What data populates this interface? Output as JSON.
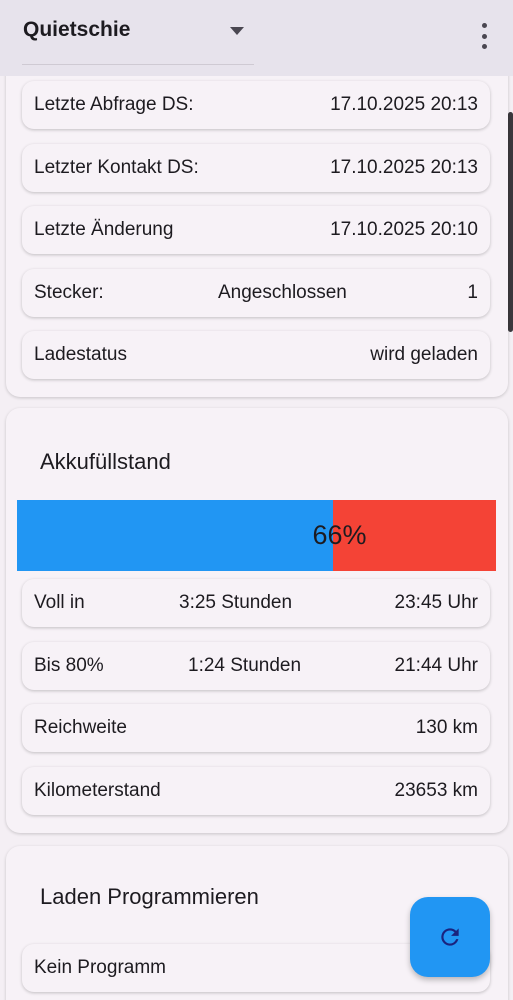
{
  "appbar": {
    "title": "Quietschie",
    "dropdown_icon": "caret-down-icon",
    "menu_icon": "more-vert-icon"
  },
  "status": {
    "last_query_label": "Letzte Abfrage DS:",
    "last_query_value": "17.10.2025 20:13",
    "last_contact_label": "Letzter Kontakt DS:",
    "last_contact_value": "17.10.2025 20:13",
    "last_change_label": "Letzte Änderung",
    "last_change_value": "17.10.2025 20:10",
    "plug_label": "Stecker:",
    "plug_state": "Angeschlossen",
    "plug_number": "1",
    "charge_label": "Ladestatus",
    "charge_value": "wird geladen"
  },
  "battery": {
    "title": "Akkufüllstand",
    "percent_label": "66%",
    "level": 0.66,
    "full_label": "Voll in",
    "full_duration": "3:25 Stunden",
    "full_time": "23:45 Uhr",
    "to80_label": "Bis 80%",
    "to80_duration": "1:24 Stunden",
    "to80_time": "21:44 Uhr",
    "range_label": "Reichweite",
    "range_value": "130 km",
    "odometer_label": "Kilometerstand",
    "odometer_value": "23653 km"
  },
  "program": {
    "title": "Laden Programmieren",
    "value": "Kein Programm"
  },
  "fab": {
    "icon": "refresh-icon"
  },
  "colors": {
    "fill": "#2196f3",
    "remaining": "#f44336",
    "fab": "#2196f3"
  }
}
